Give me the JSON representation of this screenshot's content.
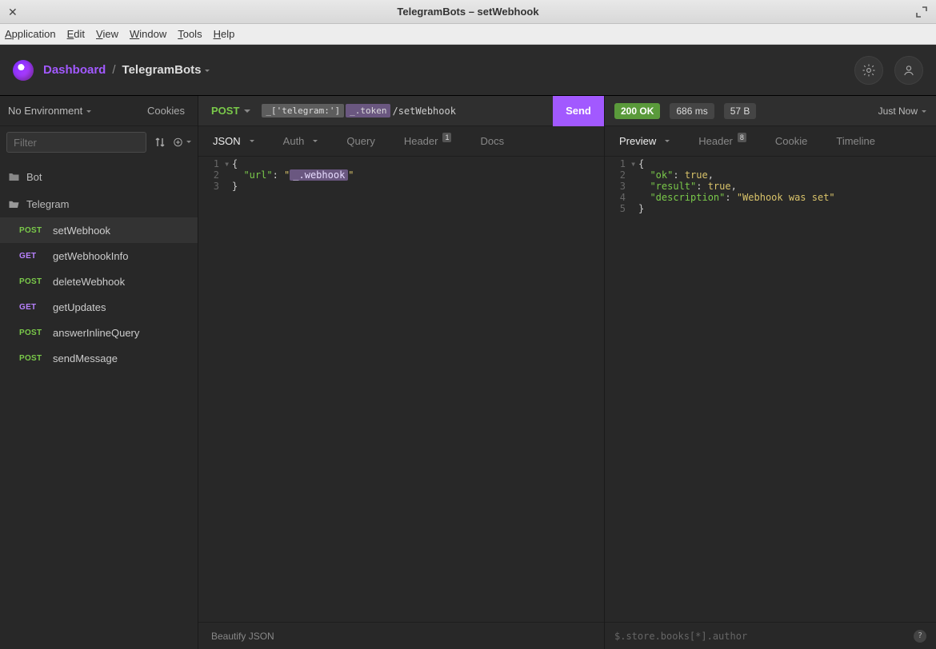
{
  "window": {
    "title": "TelegramBots – setWebhook"
  },
  "menubar": [
    "Application",
    "Edit",
    "View",
    "Window",
    "Tools",
    "Help"
  ],
  "header": {
    "dashboard_label": "Dashboard",
    "separator": "/",
    "project_label": "TelegramBots"
  },
  "sidebar": {
    "env_label": "No Environment",
    "cookies_label": "Cookies",
    "filter_placeholder": "Filter",
    "folders": [
      {
        "name": "Bot",
        "open": false
      },
      {
        "name": "Telegram",
        "open": true
      }
    ],
    "requests": [
      {
        "method": "POST",
        "name": "setWebhook",
        "selected": true
      },
      {
        "method": "GET",
        "name": "getWebhookInfo"
      },
      {
        "method": "POST",
        "name": "deleteWebhook"
      },
      {
        "method": "GET",
        "name": "getUpdates"
      },
      {
        "method": "POST",
        "name": "answerInlineQuery"
      },
      {
        "method": "POST",
        "name": "sendMessage"
      }
    ]
  },
  "request": {
    "method": "POST",
    "url_tag1": "_['telegram:']",
    "url_tag2": "_.token",
    "url_suffix": "/setWebhook",
    "send_label": "Send",
    "tabs": {
      "body": "JSON",
      "auth": "Auth",
      "query": "Query",
      "header": "Header",
      "header_badge": "1",
      "docs": "Docs"
    },
    "body_lines": {
      "l1": "{",
      "l2_key": "\"url\"",
      "l2_colon": ": ",
      "l2_q1": "\"",
      "l2_tag": "_.webhook",
      "l2_q2": "\"",
      "l3": "}"
    },
    "footer": "Beautify JSON"
  },
  "response": {
    "status_code": "200",
    "status_text": "OK",
    "time": "686 ms",
    "size": "57 B",
    "when": "Just Now",
    "tabs": {
      "preview": "Preview",
      "header": "Header",
      "header_badge": "8",
      "cookie": "Cookie",
      "timeline": "Timeline"
    },
    "body_lines": {
      "l1": "{",
      "l2_key": "\"ok\"",
      "l2_val": "true",
      "l3_key": "\"result\"",
      "l3_val": "true",
      "l4_key": "\"description\"",
      "l4_val": "\"Webhook was set\"",
      "l5": "}"
    },
    "jsonpath_placeholder": "$.store.books[*].author"
  }
}
